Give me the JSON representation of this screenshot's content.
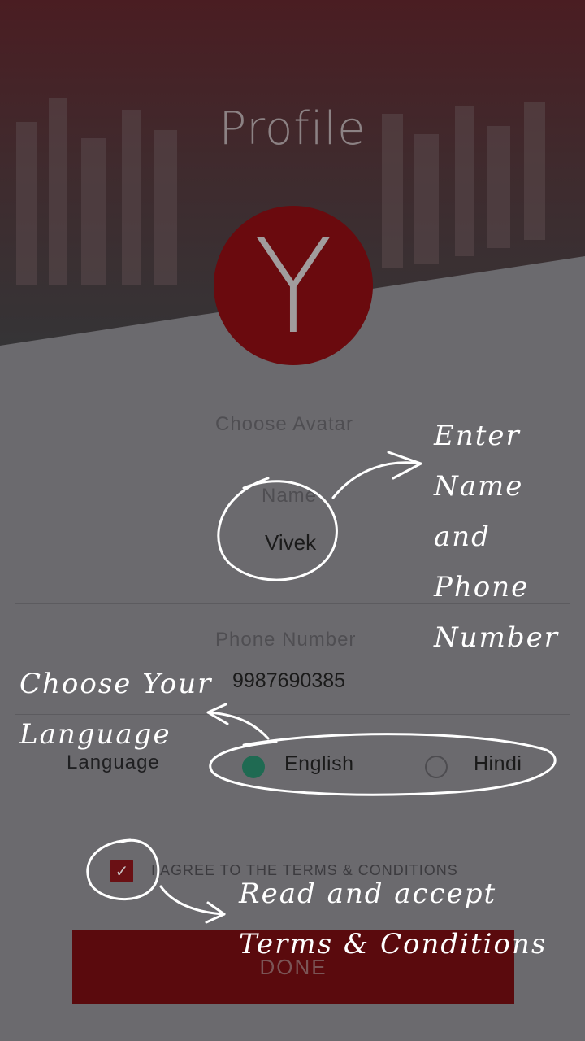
{
  "page": {
    "title": "Profile"
  },
  "avatar": {
    "letter": "Y",
    "choose_label": "Choose Avatar"
  },
  "form": {
    "name_label": "Name",
    "name_value": "Vivek",
    "phone_label": "Phone Number",
    "phone_value": "9987690385",
    "language_label": "Language",
    "language_options": [
      {
        "label": "English",
        "selected": true
      },
      {
        "label": "Hindi",
        "selected": false
      }
    ],
    "terms_checked": true,
    "terms_label": "I AGREE TO THE TERMS & CONDITIONS",
    "done_label": "DONE"
  },
  "annotations": {
    "name_phone": [
      "Enter",
      "Name",
      "and",
      "Phone",
      "Number"
    ],
    "language": [
      "Choose Your",
      "Language"
    ],
    "terms": [
      "Read and accept",
      "Terms & Conditions"
    ]
  },
  "colors": {
    "accent": "#6a0a0e",
    "radio_selected": "#1f6a52",
    "overlay_background": "#6b6a6e"
  }
}
